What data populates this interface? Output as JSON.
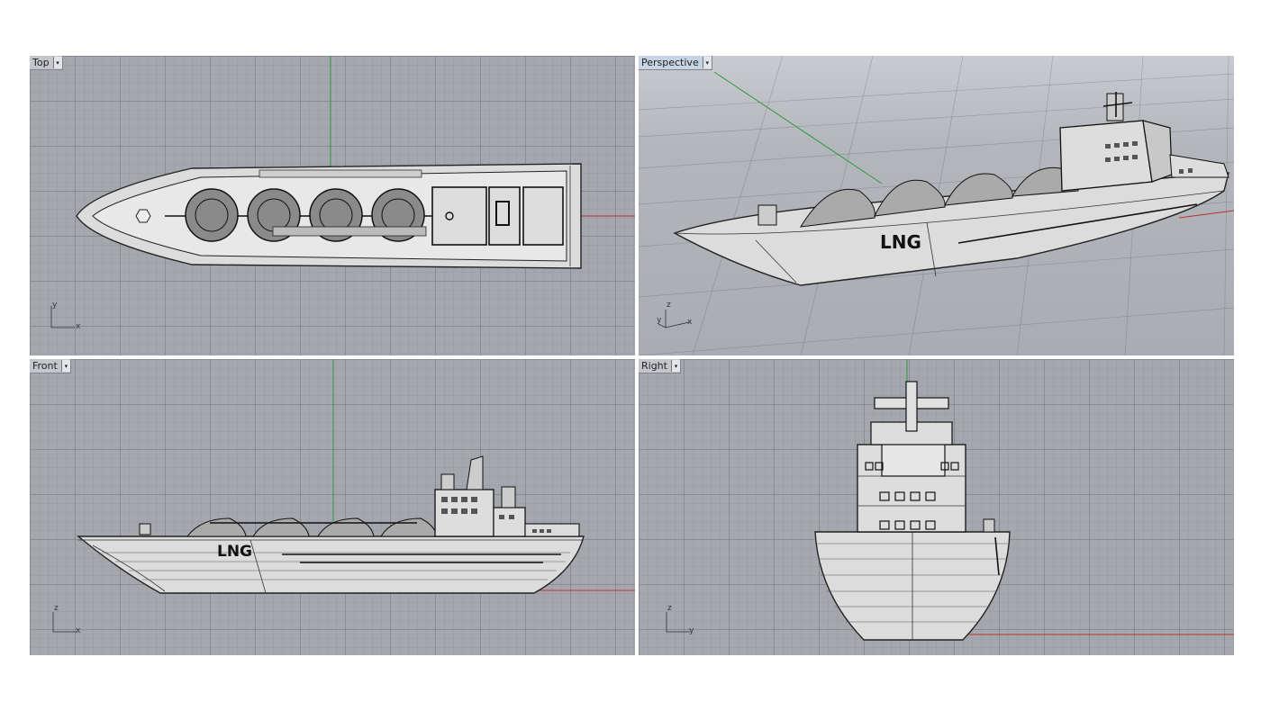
{
  "viewports": {
    "top": {
      "label": "Top",
      "axis_v": "y",
      "axis_h": "x"
    },
    "perspective": {
      "label": "Perspective",
      "axis_v": "z",
      "axis_y": "y",
      "axis_h": "x"
    },
    "front": {
      "label": "Front",
      "axis_v": "z",
      "axis_h": "x"
    },
    "right": {
      "label": "Right",
      "axis_v": "z",
      "axis_h": "y"
    }
  },
  "model": {
    "hull_text": "LNG"
  },
  "icons": {
    "viewport_menu": "dropdown-arrow-icon"
  },
  "colors": {
    "x_axis": "#c03030",
    "y_axis": "#2a9a3a",
    "viewport_bg": "#a4a7ad",
    "active_label": "#c6d4e6"
  }
}
